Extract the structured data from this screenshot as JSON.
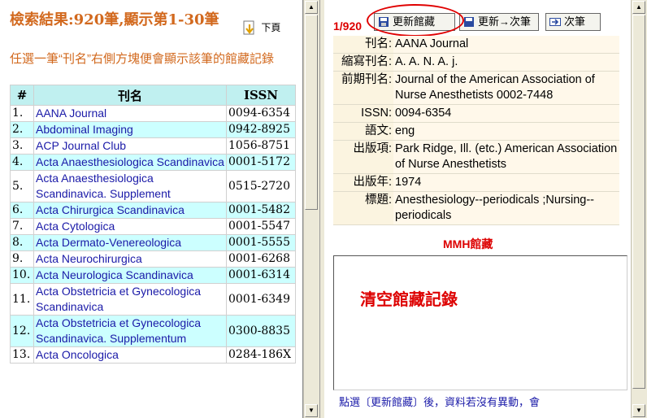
{
  "left": {
    "title": "檢索結果:920筆,顯示第1-30筆",
    "download_label": "下頁",
    "hint": "任選一筆“刊名”右側方塊便會顯示該筆的館藏記錄",
    "table_headers": {
      "num": "#",
      "title": "刊名",
      "issn": "ISSN"
    },
    "rows": [
      {
        "num": "1.",
        "title": "AANA Journal",
        "issn": "0094-6354"
      },
      {
        "num": "2.",
        "title": "Abdominal Imaging",
        "issn": "0942-8925"
      },
      {
        "num": "3.",
        "title": "ACP Journal Club",
        "issn": "1056-8751"
      },
      {
        "num": "4.",
        "title": "Acta Anaesthesiologica Scandinavica",
        "issn": "0001-5172"
      },
      {
        "num": "5.",
        "title": "Acta Anaesthesiologica Scandinavica. Supplement",
        "issn": "0515-2720"
      },
      {
        "num": "6.",
        "title": "Acta Chirurgica Scandinavica",
        "issn": "0001-5482"
      },
      {
        "num": "7.",
        "title": "Acta Cytologica",
        "issn": "0001-5547"
      },
      {
        "num": "8.",
        "title": "Acta Dermato-Venereologica",
        "issn": "0001-5555"
      },
      {
        "num": "9.",
        "title": "Acta Neurochirurgica",
        "issn": "0001-6268"
      },
      {
        "num": "10.",
        "title": "Acta Neurologica Scandinavica",
        "issn": "0001-6314"
      },
      {
        "num": "11.",
        "title": "Acta Obstetricia et Gynecologica Scandinavica",
        "issn": "0001-6349"
      },
      {
        "num": "12.",
        "title": "Acta Obstetricia et Gynecologica Scandinavica. Supplementum",
        "issn": "0300-8835"
      },
      {
        "num": "13.",
        "title": "Acta Oncologica",
        "issn": "0284-186X"
      }
    ]
  },
  "right": {
    "counter": "1/920",
    "buttons": {
      "update": "更新館藏",
      "update_next": "更新→次筆",
      "next": "次筆"
    },
    "details": [
      {
        "label": "刊名:",
        "value": "AANA Journal"
      },
      {
        "label": "縮寫刊名:",
        "value": "A. A. N. A. j."
      },
      {
        "label": "前期刊名:",
        "value": "Journal of the American Association of Nurse Anesthetists 0002-7448"
      },
      {
        "label": "ISSN:",
        "value": "0094-6354"
      },
      {
        "label": "語文:",
        "value": "eng"
      },
      {
        "label": "出版項:",
        "value": "Park Ridge, Ill. (etc.) American Association of Nurse Anesthetists"
      },
      {
        "label": "出版年:",
        "value": "1974"
      },
      {
        "label": "標題:",
        "value": "Anesthesiology--periodicals ;Nursing--periodicals"
      }
    ],
    "holdings_label": "MMH館藏",
    "clear_holdings": "清空館藏記錄",
    "bottom_note": "點選〔更新館藏〕後，資料若沒有異動，會"
  },
  "colors": {
    "accent": "#d2691e",
    "alert": "#dd0000",
    "link": "#1a1aa8",
    "row_alt": "#ccffff"
  }
}
